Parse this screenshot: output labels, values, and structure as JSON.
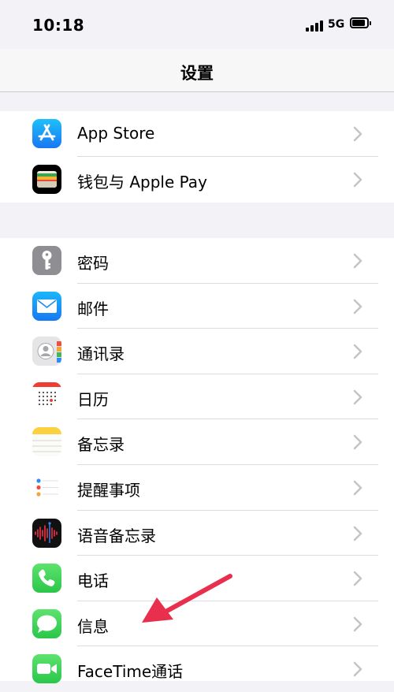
{
  "status_bar": {
    "time": "10:18",
    "network": "5G"
  },
  "nav": {
    "title": "设置"
  },
  "groups": [
    {
      "items": [
        {
          "label": "App Store",
          "icon": "app-store-icon"
        },
        {
          "label": "钱包与 Apple Pay",
          "icon": "wallet-icon"
        }
      ]
    },
    {
      "items": [
        {
          "label": "密码",
          "icon": "key-icon"
        },
        {
          "label": "邮件",
          "icon": "mail-icon"
        },
        {
          "label": "通讯录",
          "icon": "contacts-icon"
        },
        {
          "label": "日历",
          "icon": "calendar-icon"
        },
        {
          "label": "备忘录",
          "icon": "notes-icon"
        },
        {
          "label": "提醒事项",
          "icon": "reminders-icon"
        },
        {
          "label": "语音备忘录",
          "icon": "voice-memos-icon"
        },
        {
          "label": "电话",
          "icon": "phone-icon"
        },
        {
          "label": "信息",
          "icon": "messages-icon"
        },
        {
          "label": "FaceTime通话",
          "icon": "facetime-icon"
        }
      ]
    }
  ],
  "colors": {
    "background": "#f2f2f7",
    "separator": "#dcdce0",
    "chevron": "#c4c4c7",
    "annotation_arrow": "#e8304e"
  }
}
